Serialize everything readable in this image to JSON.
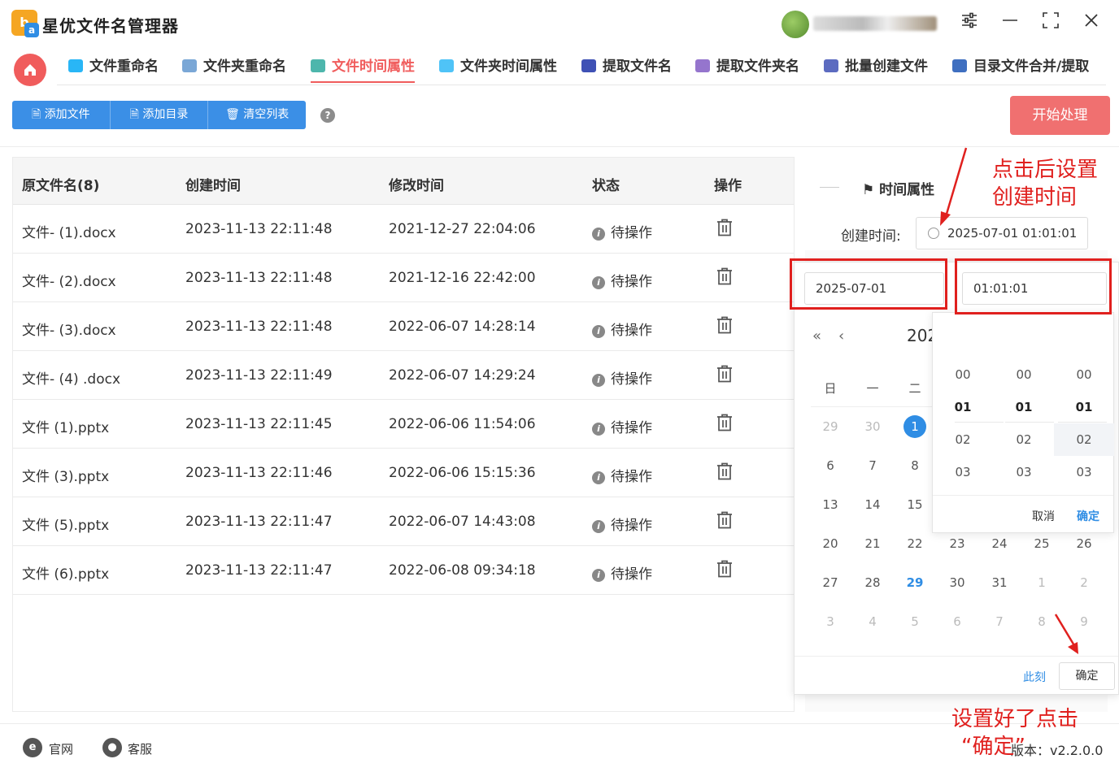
{
  "app": {
    "title": "星优文件名管理器",
    "version": "版本：v2.2.0.0"
  },
  "nav": {
    "tabs": [
      {
        "label": "文件重命名",
        "color": "#29b6f6"
      },
      {
        "label": "文件夹重命名",
        "color": "#7aa7d6"
      },
      {
        "label": "文件时间属性",
        "color": "#4db6ac"
      },
      {
        "label": "文件夹时间属性",
        "color": "#4fc3f7"
      },
      {
        "label": "提取文件名",
        "color": "#3f51b5"
      },
      {
        "label": "提取文件夹名",
        "color": "#9575cd"
      },
      {
        "label": "批量创建文件",
        "color": "#5c6bc0"
      },
      {
        "label": "目录文件合并/提取",
        "color": "#3f6fc0"
      }
    ],
    "active_index": 2
  },
  "toolbar": {
    "add_file": "添加文件",
    "add_dir": "添加目录",
    "clear_list": "清空列表",
    "help": "?",
    "start": "开始处理"
  },
  "table": {
    "headers": [
      "原文件名(8)",
      "创建时间",
      "修改时间",
      "状态",
      "操作"
    ],
    "rows": [
      {
        "name": "文件- (1).docx",
        "created": "2023-11-13 22:11:48",
        "modified": "2021-12-27 22:04:06",
        "status": "待操作"
      },
      {
        "name": "文件- (2).docx",
        "created": "2023-11-13 22:11:48",
        "modified": "2021-12-16 22:42:00",
        "status": "待操作"
      },
      {
        "name": "文件- (3).docx",
        "created": "2023-11-13 22:11:48",
        "modified": "2022-06-07 14:28:14",
        "status": "待操作"
      },
      {
        "name": "文件- (4) .docx",
        "created": "2023-11-13 22:11:49",
        "modified": "2022-06-07 14:29:24",
        "status": "待操作"
      },
      {
        "name": "文件 (1).pptx",
        "created": "2023-11-13 22:11:45",
        "modified": "2022-06-06 11:54:06",
        "status": "待操作"
      },
      {
        "name": "文件 (3).pptx",
        "created": "2023-11-13 22:11:46",
        "modified": "2022-06-06 15:15:36",
        "status": "待操作"
      },
      {
        "name": "文件 (5).pptx",
        "created": "2023-11-13 22:11:47",
        "modified": "2022-06-07 14:43:08",
        "status": "待操作"
      },
      {
        "name": "文件 (6).pptx",
        "created": "2023-11-13 22:11:47",
        "modified": "2022-06-08 09:34:18",
        "status": "待操作"
      }
    ]
  },
  "panel": {
    "title": "时间属性",
    "created_label": "创建时间:",
    "created_value": "2025-07-01 01:01:01"
  },
  "picker": {
    "date_value": "2025-07-01",
    "time_value": "01:01:01",
    "year_partial": "202",
    "weekdays": [
      "日",
      "一",
      "二"
    ],
    "days": [
      [
        "29",
        "30",
        "1"
      ],
      [
        "6",
        "7",
        "8"
      ],
      [
        "13",
        "14",
        "15"
      ],
      [
        "20",
        "21",
        "22",
        "23",
        "24",
        "25",
        "26"
      ],
      [
        "27",
        "28",
        "29",
        "30",
        "31",
        "1",
        "2"
      ],
      [
        "3",
        "4",
        "5",
        "6",
        "7",
        "8",
        "9"
      ]
    ],
    "now_label": "此刻",
    "ok_label": "确定"
  },
  "time_spinner": {
    "hours": [
      "00",
      "01",
      "02",
      "03"
    ],
    "minutes": [
      "00",
      "01",
      "02",
      "03"
    ],
    "seconds": [
      "00",
      "01",
      "02",
      "03"
    ],
    "cancel": "取消",
    "ok": "确定"
  },
  "annotations": {
    "top_line1": "点击后设置",
    "top_line2": "创建时间",
    "bottom_line1": "设置好了点击",
    "bottom_line2": "“确定”",
    "color": "#e0201e"
  },
  "footer": {
    "website": "官网",
    "support": "客服"
  }
}
